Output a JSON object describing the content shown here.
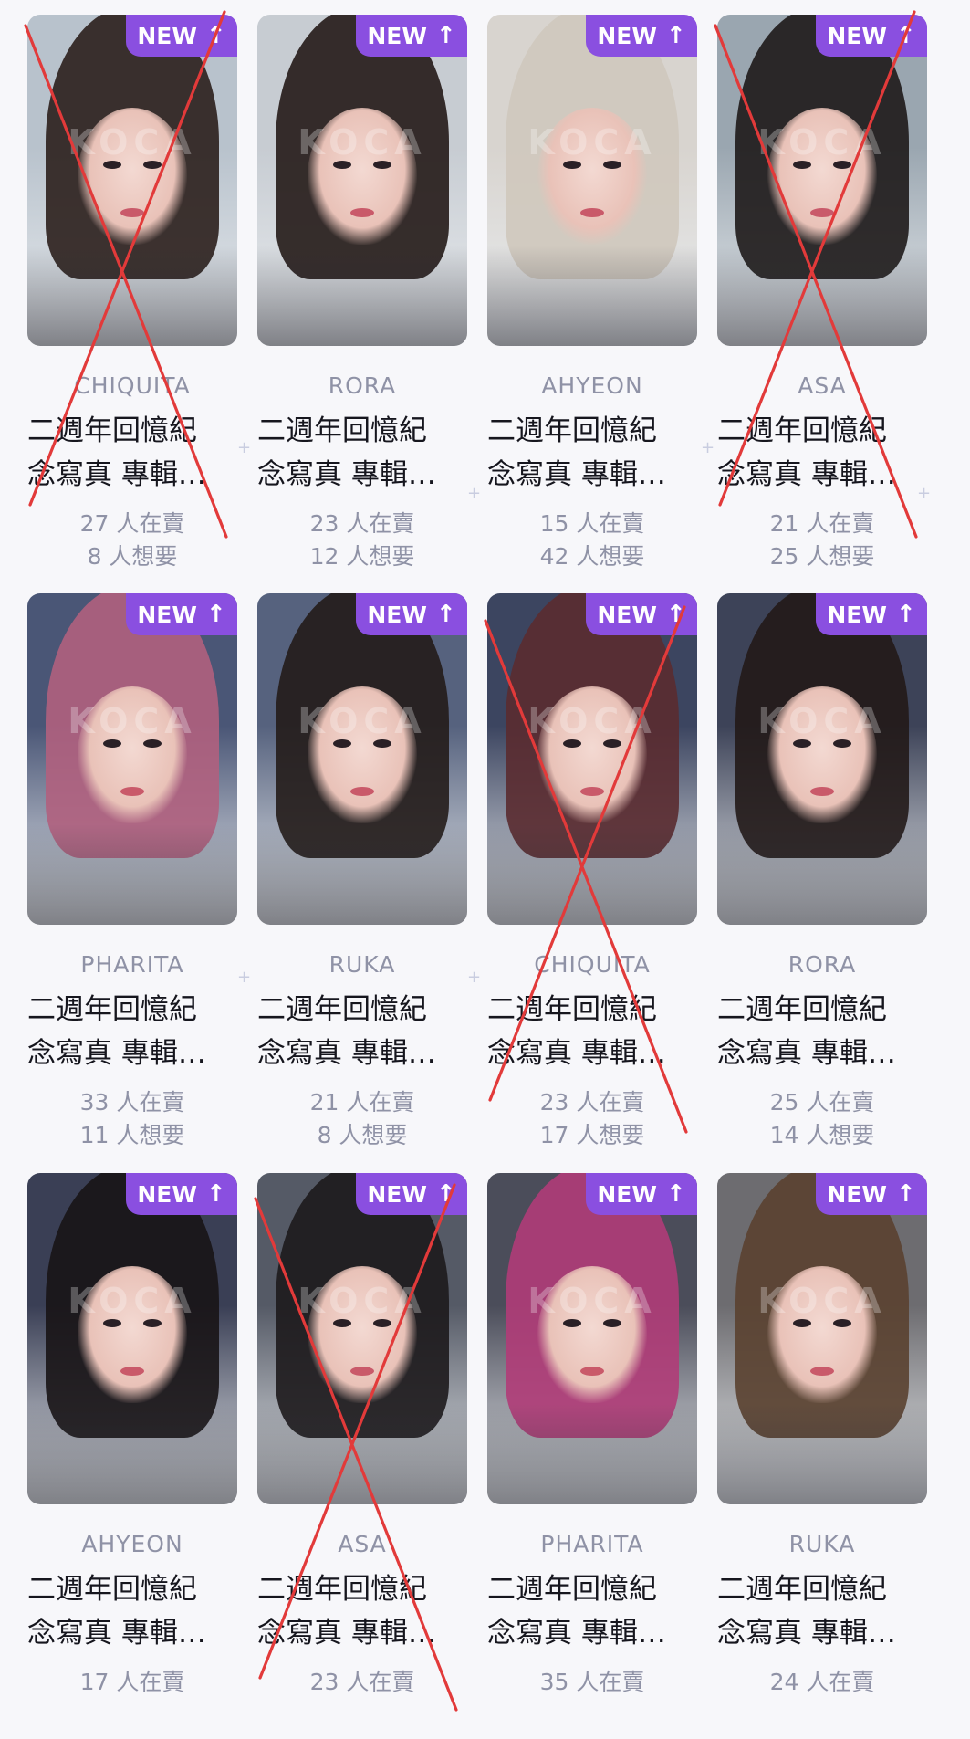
{
  "badge": {
    "label": "NEW",
    "arrow": "↑"
  },
  "watermark": "KOCA",
  "cards": [
    {
      "member": "CHIQUITA",
      "title_line1": "二週年回憶紀",
      "title_line2": "念寫真 專輯…",
      "selling": "27 人在賣",
      "wanted": "8 人想要",
      "crossed": true,
      "photo_bg": "#b8c2cc",
      "hair": "#2b1f1c"
    },
    {
      "member": "RORA",
      "title_line1": "二週年回憶紀",
      "title_line2": "念寫真 專輯…",
      "selling": "23 人在賣",
      "wanted": "12 人想要",
      "crossed": false,
      "photo_bg": "#c7ccd2",
      "hair": "#231a17"
    },
    {
      "member": "AHYEON",
      "title_line1": "二週年回憶紀",
      "title_line2": "念寫真 專輯…",
      "selling": "15 人在賣",
      "wanted": "42 人想要",
      "crossed": false,
      "photo_bg": "#d8d4cf",
      "hair": "#cfc8bd"
    },
    {
      "member": "ASA",
      "title_line1": "二週年回憶紀",
      "title_line2": "念寫真 專輯…",
      "selling": "21 人在賣",
      "wanted": "25 人想要",
      "crossed": true,
      "photo_bg": "#9aa6b0",
      "hair": "#1e1a1a"
    },
    {
      "member": "PHARITA",
      "title_line1": "二週年回憶紀",
      "title_line2": "念寫真 專輯…",
      "selling": "33 人在賣",
      "wanted": "11 人想要",
      "crossed": false,
      "photo_bg": "#4a5676",
      "hair": "#b0607e"
    },
    {
      "member": "RUKA",
      "title_line1": "二週年回憶紀",
      "title_line2": "念寫真 專輯…",
      "selling": "21 人在賣",
      "wanted": "8 人想要",
      "crossed": false,
      "photo_bg": "#56627e",
      "hair": "#241c1a"
    },
    {
      "member": "CHIQUITA",
      "title_line1": "二週年回憶紀",
      "title_line2": "念寫真 專輯…",
      "selling": "23 人在賣",
      "wanted": "17 人想要",
      "crossed": true,
      "photo_bg": "#3c4560",
      "hair": "#5a2b30"
    },
    {
      "member": "RORA",
      "title_line1": "二週年回憶紀",
      "title_line2": "念寫真 專輯…",
      "selling": "25 人在賣",
      "wanted": "14 人想要",
      "crossed": false,
      "photo_bg": "#3d4358",
      "hair": "#221a18"
    },
    {
      "member": "AHYEON",
      "title_line1": "二週年回憶紀",
      "title_line2": "念寫真 專輯…",
      "selling": "17 人在賣",
      "wanted": "",
      "crossed": false,
      "photo_bg": "#3a3f55",
      "hair": "#181416"
    },
    {
      "member": "ASA",
      "title_line1": "二週年回憶紀",
      "title_line2": "念寫真 專輯…",
      "selling": "23 人在賣",
      "wanted": "",
      "crossed": true,
      "photo_bg": "#555a66",
      "hair": "#1d1a1c"
    },
    {
      "member": "PHARITA",
      "title_line1": "二週年回憶紀",
      "title_line2": "念寫真 專輯…",
      "selling": "35 人在賣",
      "wanted": "",
      "crossed": false,
      "photo_bg": "#4b4d5a",
      "hair": "#b03c78"
    },
    {
      "member": "RUKA",
      "title_line1": "二週年回憶紀",
      "title_line2": "念寫真 專輯…",
      "selling": "24 人在賣",
      "wanted": "",
      "crossed": false,
      "photo_bg": "#6d6c70",
      "hair": "#5a4130"
    }
  ]
}
